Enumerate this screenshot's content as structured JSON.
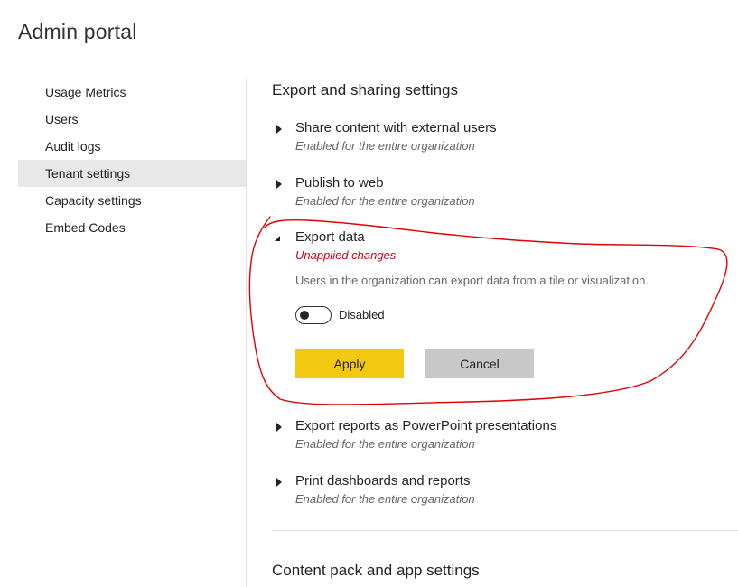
{
  "page": {
    "title": "Admin portal"
  },
  "sidebar": {
    "items": [
      {
        "label": "Usage Metrics"
      },
      {
        "label": "Users"
      },
      {
        "label": "Audit logs"
      },
      {
        "label": "Tenant settings"
      },
      {
        "label": "Capacity settings"
      },
      {
        "label": "Embed Codes"
      }
    ],
    "selected": "Tenant settings"
  },
  "main": {
    "section_title": "Export and sharing settings",
    "settings": [
      {
        "title": "Share content with external users",
        "status": "Enabled for the entire organization",
        "expanded": false
      },
      {
        "title": "Publish to web",
        "status": "Enabled for the entire organization",
        "expanded": false
      },
      {
        "title": "Export data",
        "status": "Unapplied changes",
        "expanded": true,
        "description": "Users in the organization can export data from a tile or visualization.",
        "toggle_label": "Disabled",
        "toggle_on": false,
        "apply_label": "Apply",
        "cancel_label": "Cancel"
      },
      {
        "title": "Export reports as PowerPoint presentations",
        "status": "Enabled for the entire organization",
        "expanded": false
      },
      {
        "title": "Print dashboards and reports",
        "status": "Enabled for the entire organization",
        "expanded": false
      }
    ],
    "next_section_title": "Content pack and app settings"
  },
  "colors": {
    "apply_button": "#f2c811",
    "cancel_button": "#c8c8c8",
    "unapplied_status": "#d0021b",
    "selected_nav": "#e8e8e8",
    "annotation_stroke": "#e00000"
  },
  "icons": {
    "collapsed": "caret-right-icon",
    "expanded": "caret-down-icon"
  }
}
